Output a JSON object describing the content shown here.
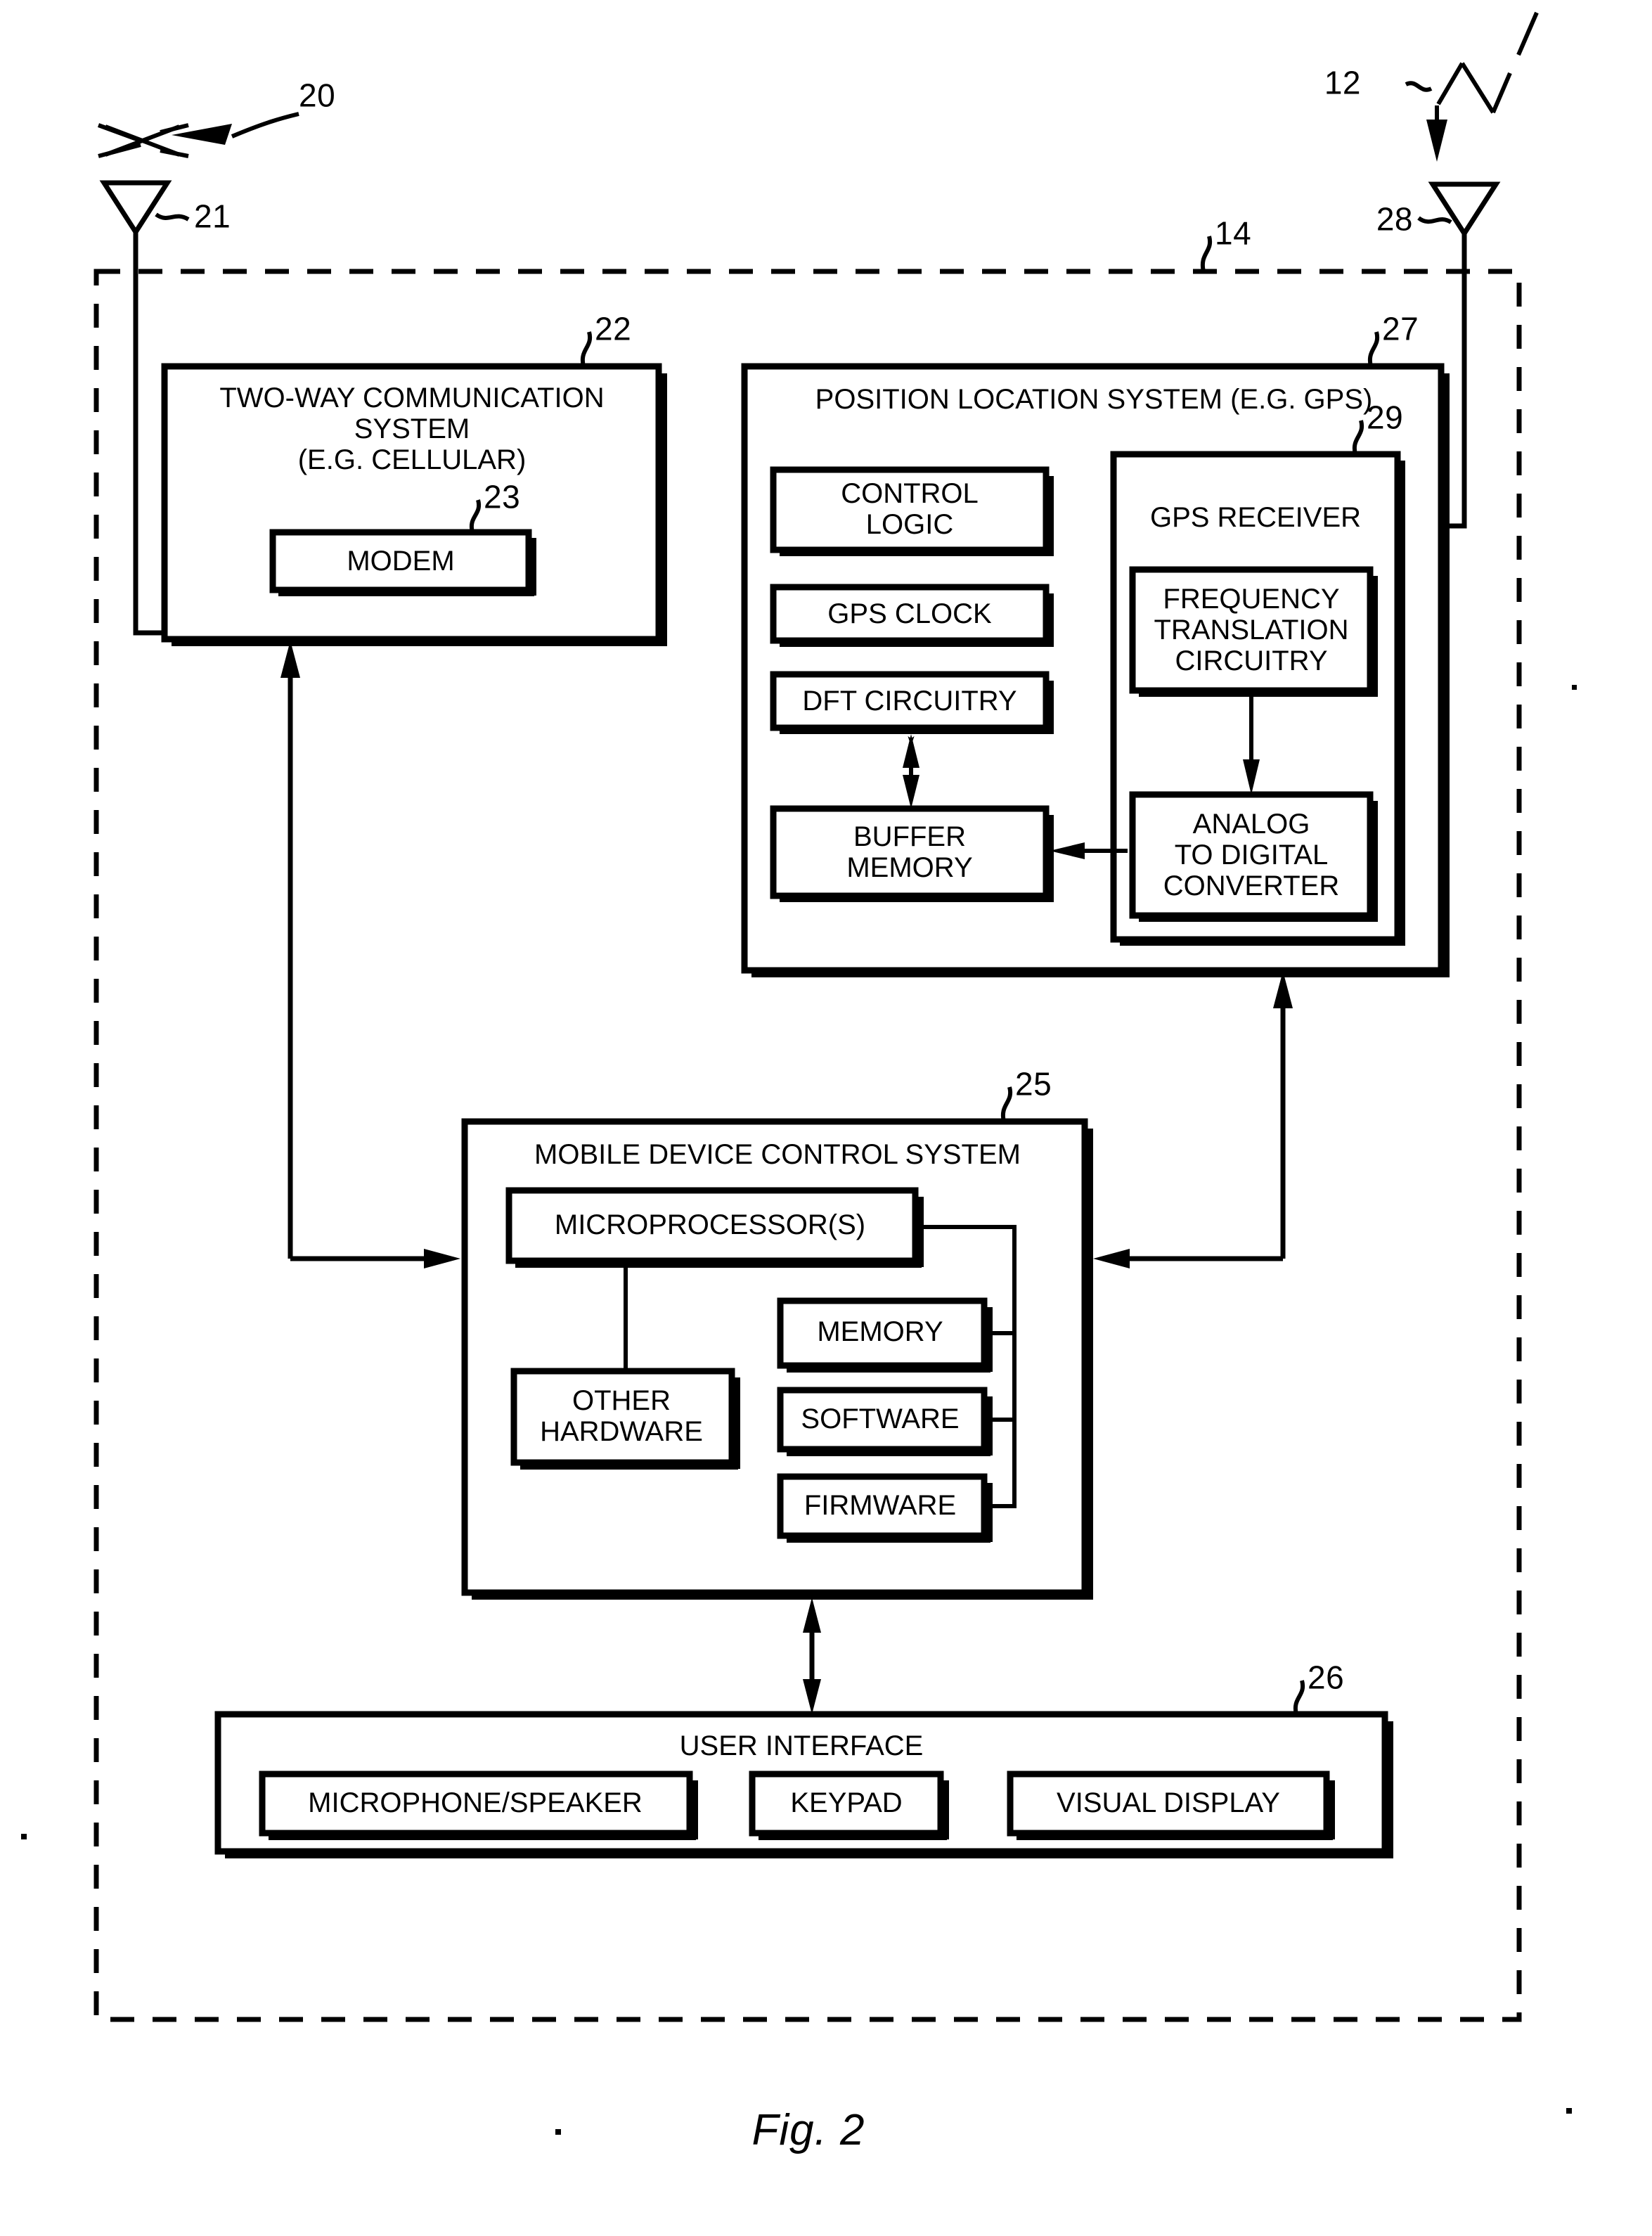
{
  "figure": {
    "caption": "Fig. 2",
    "outer_boundary_ref": "14"
  },
  "refs": {
    "satellite_signal": "20",
    "gps_signal": "12",
    "cellular_antenna": "21",
    "gps_antenna": "28",
    "device_boundary": "14",
    "two_way_system": "22",
    "modem": "23",
    "position_location_system": "27",
    "gps_receiver": "29",
    "mobile_device_control_system": "25",
    "user_interface": "26"
  },
  "blocks": {
    "two_way": {
      "title_line1": "TWO-WAY COMMUNICATION",
      "title_line2": "SYSTEM",
      "title_line3": "(E.G. CELLULAR)",
      "modem": "MODEM"
    },
    "position_location": {
      "title": "POSITION LOCATION SYSTEM (E.G. GPS)",
      "control_logic_line1": "CONTROL",
      "control_logic_line2": "LOGIC",
      "gps_clock": "GPS CLOCK",
      "dft_circuitry": "DFT CIRCUITRY",
      "buffer_memory_line1": "BUFFER",
      "buffer_memory_line2": "MEMORY",
      "gps_receiver": {
        "title": "GPS RECEIVER",
        "freq_trans_line1": "FREQUENCY",
        "freq_trans_line2": "TRANSLATION",
        "freq_trans_line3": "CIRCUITRY",
        "adc_line1": "ANALOG",
        "adc_line2": "TO DIGITAL",
        "adc_line3": "CONVERTER"
      }
    },
    "mobile_control": {
      "title": "MOBILE DEVICE CONTROL SYSTEM",
      "microprocessor": "MICROPROCESSOR(S)",
      "other_hardware_line1": "OTHER",
      "other_hardware_line2": "HARDWARE",
      "memory": "MEMORY",
      "software": "SOFTWARE",
      "firmware": "FIRMWARE"
    },
    "user_interface": {
      "title": "USER INTERFACE",
      "microphone_speaker": "MICROPHONE/SPEAKER",
      "keypad": "KEYPAD",
      "visual_display": "VISUAL DISPLAY"
    }
  },
  "colors": {
    "ink": "#000000",
    "paper": "#ffffff"
  }
}
